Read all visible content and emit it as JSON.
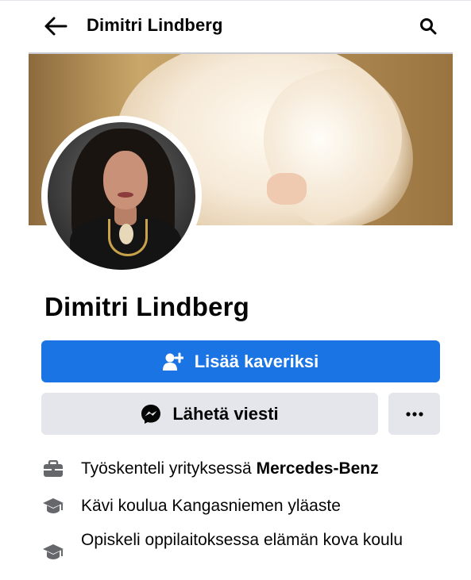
{
  "header": {
    "title": "Dimitri Lindberg",
    "back_icon": "arrow-left-icon",
    "search_icon": "search-icon"
  },
  "profile": {
    "name": "Dimitri Lindberg",
    "cover_photo": "cover-photo",
    "profile_picture": "profile-picture"
  },
  "actions": {
    "add_friend_label": "Lisää kaveriksi",
    "add_friend_icon": "add-friend-icon",
    "message_label": "Lähetä viesti",
    "message_icon": "messenger-icon",
    "more_label": "•••",
    "more_icon": "more-dots-icon"
  },
  "intro": {
    "work_prefix": "Työskenteli yrityksessä ",
    "work_place": "Mercedes-Benz",
    "work_icon": "briefcase-icon",
    "school_text": "Kävi koulua Kangasniemen yläaste",
    "school_icon": "graduation-cap-icon",
    "college_text": "Opiskeli oppilaitoksessa elämän kova koulu",
    "college_icon": "graduation-cap-icon"
  },
  "colors": {
    "primary": "#1b74e4",
    "secondary_bg": "#e4e6eb",
    "text": "#050505",
    "icon_gray": "#65676b"
  }
}
